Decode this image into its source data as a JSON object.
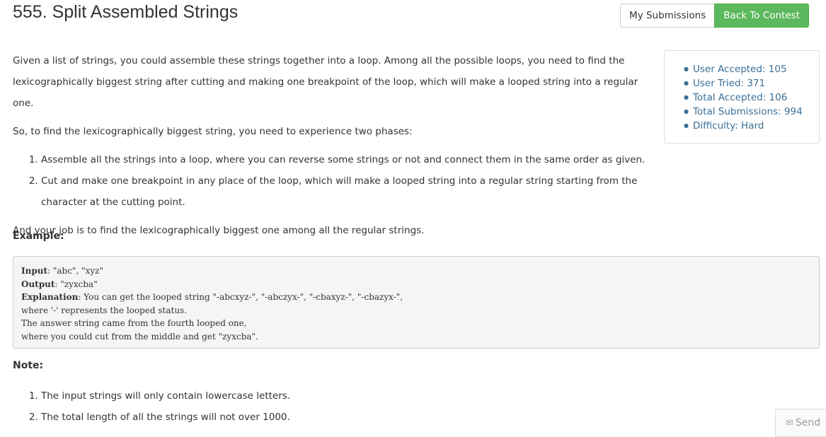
{
  "header": {
    "title": "555. Split Assembled Strings",
    "my_submissions": "My Submissions",
    "back_to_contest": "Back To Contest"
  },
  "stats": [
    "User Accepted: 105",
    "User Tried: 371",
    "Total Accepted: 106",
    "Total Submissions: 994",
    "Difficulty: Hard"
  ],
  "description": {
    "p1": "Given a list of strings, you could assemble these strings together into a loop. Among all the possible loops, you need to find the lexicographically biggest string after cutting and making one breakpoint of the loop, which will make a looped string into a regular one.",
    "p2": "So, to find the lexicographically biggest string, you need to experience two phases:",
    "phases": [
      "Assemble all the strings into a loop, where you can reverse some strings or not and connect them in the same order as given.",
      "Cut and make one breakpoint in any place of the loop, which will make a looped string into a regular string starting from the character at the cutting point."
    ],
    "p3": "And your job is to find the lexicographically biggest one among all the regular strings."
  },
  "example": {
    "heading": "Example:",
    "input_label": "Input",
    "input_value": ": \"abc\", \"xyz\"",
    "output_label": "Output",
    "output_value": ": \"zyxcba\"",
    "explanation_label": "Explanation",
    "explanation_value": ": You can get the looped string \"-abcxyz-\", \"-abczyx-\", \"-cbaxyz-\", \"-cbazyx-\",",
    "line4": "where '-' represents the looped status.",
    "line5": "The answer string came from the fourth looped one,",
    "line6": "where you could cut from the middle and get \"zyxcba\"."
  },
  "note": {
    "heading": "Note:",
    "items": [
      "The input strings will only contain lowercase letters.",
      "The total length of all the strings will not over 1000."
    ]
  },
  "send": {
    "icon": "envelope-icon",
    "label": "Send"
  }
}
